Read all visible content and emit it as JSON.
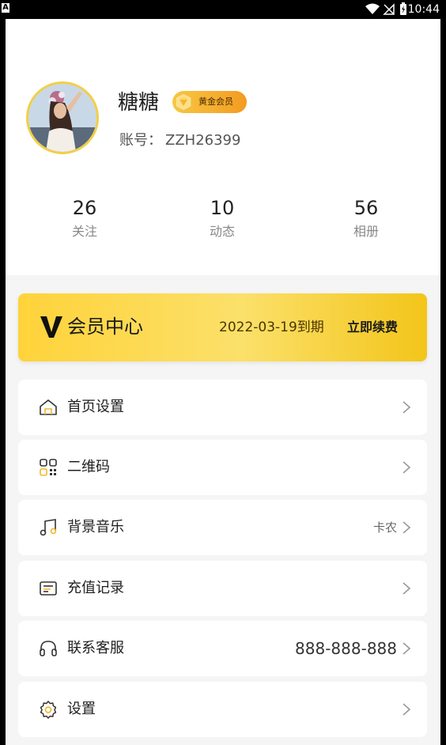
{
  "status_bar": {
    "corner_letter": "A",
    "time": "10:44"
  },
  "profile": {
    "username": "糖糖",
    "badge": "黄金会员",
    "account_label": "账号：",
    "account_value": "ZZH26399",
    "stats": [
      {
        "value": "26",
        "label": "关注"
      },
      {
        "value": "10",
        "label": "动态"
      },
      {
        "value": "56",
        "label": "相册"
      }
    ]
  },
  "vip_card": {
    "logo": "V",
    "title": "会员中心",
    "expiry": "2022-03-19到期",
    "renew": "立即续费"
  },
  "menu": [
    {
      "icon": "home-icon",
      "label": "首页设置",
      "value": ""
    },
    {
      "icon": "qrcode-icon",
      "label": "二维码",
      "value": ""
    },
    {
      "icon": "music-note-icon",
      "label": "背景音乐",
      "value": "卡农"
    },
    {
      "icon": "record-icon",
      "label": "充值记录",
      "value": ""
    },
    {
      "icon": "headphones-icon",
      "label": "联系客服",
      "value": "888-888-888"
    },
    {
      "icon": "gear-icon",
      "label": "设置",
      "value": ""
    }
  ],
  "colors": {
    "accent": "#f7c843",
    "vip_gradient_start": "#ffd33a",
    "vip_gradient_end": "#f3c51a"
  }
}
